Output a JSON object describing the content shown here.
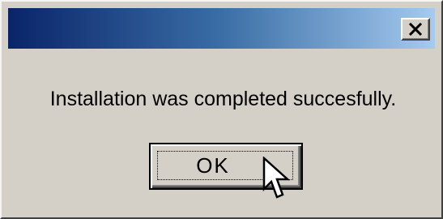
{
  "dialog": {
    "title": "",
    "message": "Installation was completed succesfully.",
    "ok_label": "OK",
    "close_label": "Close"
  },
  "icons": {
    "close": "close-x-icon",
    "cursor": "mouse-pointer-icon"
  },
  "colors": {
    "face": "#d4d0c8",
    "title_gradient_start": "#0a246a",
    "title_gradient_end": "#a6caf0",
    "text": "#000000"
  }
}
